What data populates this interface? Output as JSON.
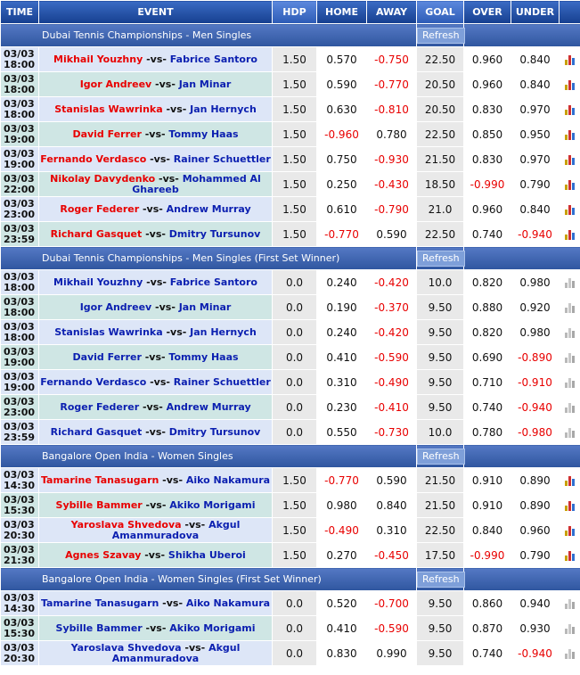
{
  "headers": [
    "TIME",
    "EVENT",
    "HDP",
    "HOME",
    "AWAY",
    "GOAL",
    "OVER",
    "UNDER"
  ],
  "refresh_label": "Refresh",
  "leagues": [
    {
      "name": "Dubai Tennis Championships - Men Singles",
      "stats_icon": "color",
      "matches": [
        {
          "date": "03/03",
          "time": "18:00",
          "home": "Mikhail Youzhny",
          "away": "Fabrice Santoro",
          "home_fav": true,
          "hdp": "1.50",
          "home_odds": "0.570",
          "away_odds": "-0.750",
          "goal": "22.50",
          "over": "0.960",
          "under": "0.840"
        },
        {
          "date": "03/03",
          "time": "18:00",
          "home": "Igor Andreev",
          "away": "Jan Minar",
          "home_fav": true,
          "hdp": "1.50",
          "home_odds": "0.590",
          "away_odds": "-0.770",
          "goal": "20.50",
          "over": "0.960",
          "under": "0.840"
        },
        {
          "date": "03/03",
          "time": "18:00",
          "home": "Stanislas Wawrinka",
          "away": "Jan Hernych",
          "home_fav": true,
          "hdp": "1.50",
          "home_odds": "0.630",
          "away_odds": "-0.810",
          "goal": "20.50",
          "over": "0.830",
          "under": "0.970"
        },
        {
          "date": "03/03",
          "time": "19:00",
          "home": "David Ferrer",
          "away": "Tommy Haas",
          "home_fav": true,
          "hdp": "1.50",
          "home_odds": "-0.960",
          "away_odds": "0.780",
          "goal": "22.50",
          "over": "0.850",
          "under": "0.950"
        },
        {
          "date": "03/03",
          "time": "19:00",
          "home": "Fernando Verdasco",
          "away": "Rainer Schuettler",
          "home_fav": true,
          "hdp": "1.50",
          "home_odds": "0.750",
          "away_odds": "-0.930",
          "goal": "21.50",
          "over": "0.830",
          "under": "0.970"
        },
        {
          "date": "03/03",
          "time": "22:00",
          "home": "Nikolay Davydenko",
          "away": "Mohammed Al Ghareeb",
          "home_fav": true,
          "hdp": "1.50",
          "home_odds": "0.250",
          "away_odds": "-0.430",
          "goal": "18.50",
          "over": "-0.990",
          "under": "0.790"
        },
        {
          "date": "03/03",
          "time": "23:00",
          "home": "Roger Federer",
          "away": "Andrew Murray",
          "home_fav": true,
          "hdp": "1.50",
          "home_odds": "0.610",
          "away_odds": "-0.790",
          "goal": "21.0",
          "over": "0.960",
          "under": "0.840"
        },
        {
          "date": "03/03",
          "time": "23:59",
          "home": "Richard Gasquet",
          "away": "Dmitry Tursunov",
          "home_fav": true,
          "hdp": "1.50",
          "home_odds": "-0.770",
          "away_odds": "0.590",
          "goal": "22.50",
          "over": "0.740",
          "under": "-0.940"
        }
      ]
    },
    {
      "name": "Dubai Tennis Championships - Men Singles (First Set Winner)",
      "stats_icon": "gray",
      "matches": [
        {
          "date": "03/03",
          "time": "18:00",
          "home": "Mikhail Youzhny",
          "away": "Fabrice Santoro",
          "home_fav": false,
          "hdp": "0.0",
          "home_odds": "0.240",
          "away_odds": "-0.420",
          "goal": "10.0",
          "over": "0.820",
          "under": "0.980"
        },
        {
          "date": "03/03",
          "time": "18:00",
          "home": "Igor Andreev",
          "away": "Jan Minar",
          "home_fav": false,
          "hdp": "0.0",
          "home_odds": "0.190",
          "away_odds": "-0.370",
          "goal": "9.50",
          "over": "0.880",
          "under": "0.920"
        },
        {
          "date": "03/03",
          "time": "18:00",
          "home": "Stanislas Wawrinka",
          "away": "Jan Hernych",
          "home_fav": false,
          "hdp": "0.0",
          "home_odds": "0.240",
          "away_odds": "-0.420",
          "goal": "9.50",
          "over": "0.820",
          "under": "0.980"
        },
        {
          "date": "03/03",
          "time": "19:00",
          "home": "David Ferrer",
          "away": "Tommy Haas",
          "home_fav": false,
          "hdp": "0.0",
          "home_odds": "0.410",
          "away_odds": "-0.590",
          "goal": "9.50",
          "over": "0.690",
          "under": "-0.890"
        },
        {
          "date": "03/03",
          "time": "19:00",
          "home": "Fernando Verdasco",
          "away": "Rainer Schuettler",
          "home_fav": false,
          "hdp": "0.0",
          "home_odds": "0.310",
          "away_odds": "-0.490",
          "goal": "9.50",
          "over": "0.710",
          "under": "-0.910"
        },
        {
          "date": "03/03",
          "time": "23:00",
          "home": "Roger Federer",
          "away": "Andrew Murray",
          "home_fav": false,
          "hdp": "0.0",
          "home_odds": "0.230",
          "away_odds": "-0.410",
          "goal": "9.50",
          "over": "0.740",
          "under": "-0.940"
        },
        {
          "date": "03/03",
          "time": "23:59",
          "home": "Richard Gasquet",
          "away": "Dmitry Tursunov",
          "home_fav": false,
          "hdp": "0.0",
          "home_odds": "0.550",
          "away_odds": "-0.730",
          "goal": "10.0",
          "over": "0.780",
          "under": "-0.980"
        }
      ]
    },
    {
      "name": "Bangalore Open India - Women Singles",
      "stats_icon": "color",
      "matches": [
        {
          "date": "03/03",
          "time": "14:30",
          "home": "Tamarine Tanasugarn",
          "away": "Aiko Nakamura",
          "home_fav": true,
          "hdp": "1.50",
          "home_odds": "-0.770",
          "away_odds": "0.590",
          "goal": "21.50",
          "over": "0.910",
          "under": "0.890"
        },
        {
          "date": "03/03",
          "time": "15:30",
          "home": "Sybille Bammer",
          "away": "Akiko Morigami",
          "home_fav": true,
          "hdp": "1.50",
          "home_odds": "0.980",
          "away_odds": "0.840",
          "goal": "21.50",
          "over": "0.910",
          "under": "0.890"
        },
        {
          "date": "03/03",
          "time": "20:30",
          "home": "Yaroslava Shvedova",
          "away": "Akgul Amanmuradova",
          "home_fav": true,
          "hdp": "1.50",
          "home_odds": "-0.490",
          "away_odds": "0.310",
          "goal": "22.50",
          "over": "0.840",
          "under": "0.960"
        },
        {
          "date": "03/03",
          "time": "21:30",
          "home": "Agnes Szavay",
          "away": "Shikha Uberoi",
          "home_fav": true,
          "hdp": "1.50",
          "home_odds": "0.270",
          "away_odds": "-0.450",
          "goal": "17.50",
          "over": "-0.990",
          "under": "0.790"
        }
      ]
    },
    {
      "name": "Bangalore Open India - Women Singles (First Set Winner)",
      "stats_icon": "gray",
      "matches": [
        {
          "date": "03/03",
          "time": "14:30",
          "home": "Tamarine Tanasugarn",
          "away": "Aiko Nakamura",
          "home_fav": false,
          "hdp": "0.0",
          "home_odds": "0.520",
          "away_odds": "-0.700",
          "goal": "9.50",
          "over": "0.860",
          "under": "0.940"
        },
        {
          "date": "03/03",
          "time": "15:30",
          "home": "Sybille Bammer",
          "away": "Akiko Morigami",
          "home_fav": false,
          "hdp": "0.0",
          "home_odds": "0.410",
          "away_odds": "-0.590",
          "goal": "9.50",
          "over": "0.870",
          "under": "0.930"
        },
        {
          "date": "03/03",
          "time": "20:30",
          "home": "Yaroslava Shvedova",
          "away": "Akgul Amanmuradova",
          "home_fav": false,
          "hdp": "0.0",
          "home_odds": "0.830",
          "away_odds": "0.990",
          "goal": "9.50",
          "over": "0.740",
          "under": "-0.940"
        }
      ]
    }
  ]
}
